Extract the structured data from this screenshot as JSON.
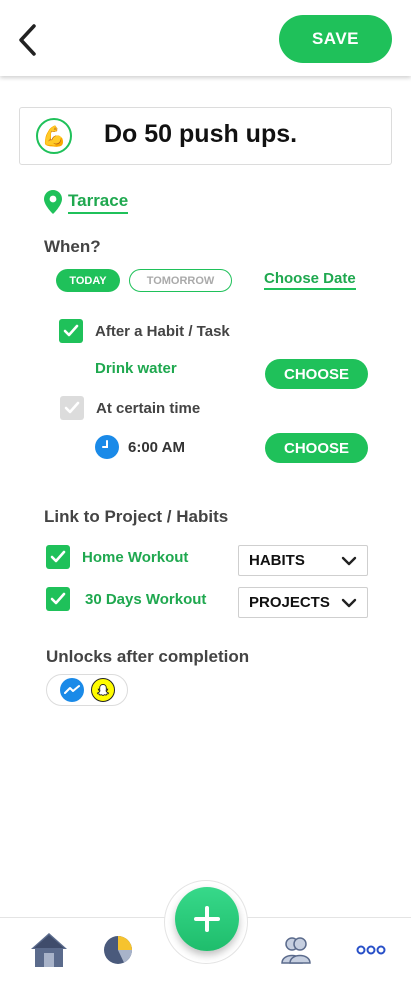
{
  "header": {
    "save_label": "SAVE",
    "back_icon": "chevron-left-icon"
  },
  "task": {
    "icon": "flexed-biceps-icon",
    "title": "Do 50 push ups."
  },
  "location": {
    "icon": "map-pin-icon",
    "name": "Tarrace"
  },
  "when": {
    "label": "When?",
    "today_label": "TODAY",
    "tomorrow_label": "TOMORROW",
    "choose_date_label": "Choose Date"
  },
  "trigger": {
    "after_habit_label": "After a Habit /  Task",
    "after_habit_checked": true,
    "habit_value": "Drink water",
    "choose_label": "CHOOSE",
    "certain_time_label": "At certain time",
    "certain_time_checked": false,
    "time_value": "6:00 AM",
    "choose_time_label": "CHOOSE"
  },
  "link": {
    "label": "Link to Project / Habits",
    "items": [
      {
        "name": "Home Workout",
        "checked": true,
        "type": "HABITS"
      },
      {
        "name": "30 Days Workout",
        "checked": true,
        "type": "PROJECTS"
      }
    ]
  },
  "unlocks": {
    "label": "Unlocks after completion",
    "apps": [
      "messenger-icon",
      "snapchat-icon"
    ]
  },
  "bottom_nav": {
    "items": [
      "home-icon",
      "pie-chart-icon",
      "add-icon",
      "people-icon",
      "more-icon"
    ]
  },
  "colors": {
    "accent": "#1fc15a",
    "accent_text": "#1fa84f",
    "clock": "#1a8ae8"
  }
}
